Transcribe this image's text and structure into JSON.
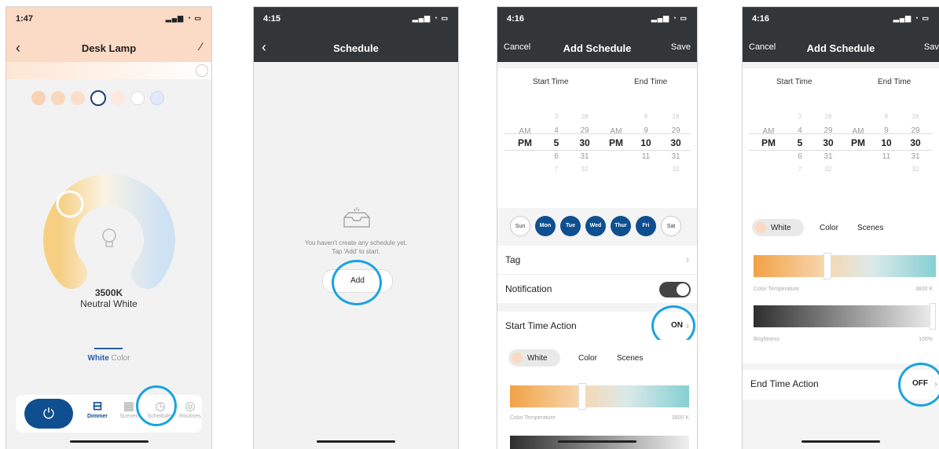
{
  "phone1": {
    "time": "1:47",
    "signal_icons": "▂▄▆ ◔ ▭",
    "title": "Desk Lamp",
    "back": "‹",
    "edit": "⁄",
    "temperature": "3500K",
    "color_name": "Neutral White",
    "mode_white": "White",
    "mode_color": "Color",
    "power": "⏻",
    "tabs": [
      "Dimmer",
      "Scenes",
      "Schedules",
      "Routines"
    ],
    "dot_colors": [
      "#f9d2b3",
      "#fad8bd",
      "#fbdfca",
      "#ffffff",
      "#fde9dd",
      "#ffffff",
      "#e2e9fa"
    ],
    "accent": "#0f4f90"
  },
  "phone2": {
    "time": "4:15",
    "signal_icons": "▂▄▆ ◔ ▭",
    "title": "Schedule",
    "back": "‹",
    "empty_line1": "You haven't create any schedule yet.",
    "empty_line2": "Tap 'Add' to start.",
    "add": "Add"
  },
  "phone3": {
    "time": "4:16",
    "signal_icons": "▂▄▆ ◔ ▭",
    "cancel": "Cancel",
    "title": "Add Schedule",
    "save": "Save",
    "start_time": "Start Time",
    "end_time": "End Time",
    "picker": {
      "ampm": [
        "AM",
        "PM"
      ],
      "start_hours": [
        "3",
        "4",
        "5",
        "6",
        "7"
      ],
      "start_minutes": [
        "28",
        "29",
        "30",
        "31",
        "32"
      ],
      "end_hours": [
        "8",
        "9",
        "10",
        "11"
      ],
      "end_minutes": [
        "28",
        "29",
        "30",
        "31",
        "32"
      ]
    },
    "days": [
      "Sun",
      "Mon",
      "Tue",
      "Wed",
      "Thur",
      "Fri",
      "Sat"
    ],
    "tag": "Tag",
    "notification": "Notification",
    "start_action": "Start Time Action",
    "start_action_value": "ON",
    "chevron": "›",
    "white": "White",
    "color": "Color",
    "scenes": "Scenes",
    "color_temp_label": "Color Temperature",
    "color_temp_value": "3800 K",
    "color_temp_level": 0.4
  },
  "phone4": {
    "time": "4:16",
    "signal_icons": "▂▄▆ ◔ ▭",
    "cancel": "Cancel",
    "title": "Add Schedule",
    "save": "Save",
    "start_time": "Start Time",
    "end_time": "End Time",
    "picker": {
      "ampm": [
        "AM",
        "PM"
      ],
      "start_hours": [
        "3",
        "4",
        "5",
        "6",
        "7"
      ],
      "start_minutes": [
        "28",
        "29",
        "30",
        "31",
        "32"
      ],
      "end_hours": [
        "8",
        "9",
        "10",
        "11"
      ],
      "end_minutes": [
        "28",
        "29",
        "30",
        "31",
        "32"
      ]
    },
    "white": "White",
    "color": "Color",
    "scenes": "Scenes",
    "color_temp_label": "Color Temperature",
    "color_temp_value": "3800 K",
    "color_temp_level": 0.4,
    "brightness_label": "Brightness",
    "brightness_value": "100%",
    "brightness_level": 1.0,
    "end_action": "End Time Action",
    "end_action_value": "OFF",
    "chevron": "›"
  },
  "highlight_color": "#1aa3e0"
}
